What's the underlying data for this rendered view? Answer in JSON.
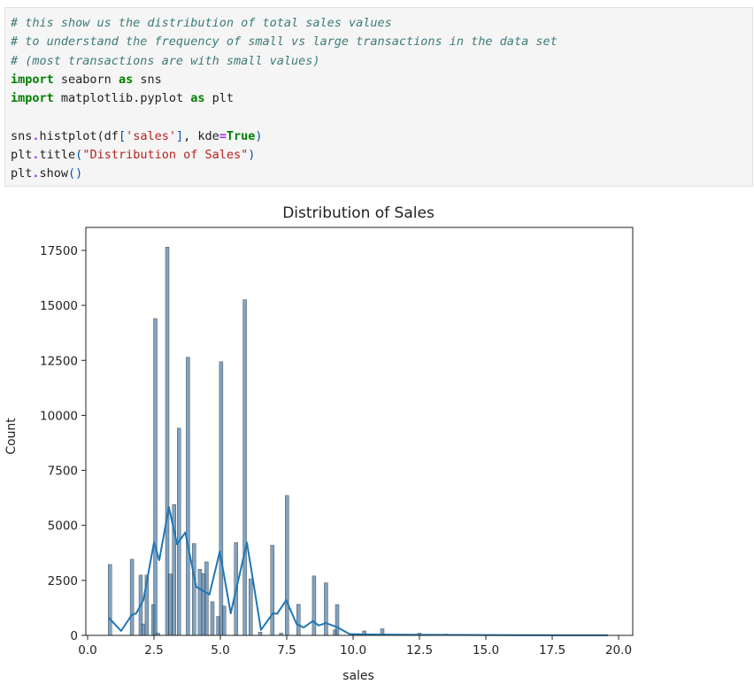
{
  "code_cell": {
    "comment1": "# this show us the distribution of total sales values",
    "comment2": "# to understand the frequency of small vs large transactions in the data set",
    "comment3": "# (most transactions are with small values)",
    "kw_import": "import",
    "kw_as": "as",
    "mod1": " seaborn ",
    "alias1": " sns",
    "mod2": " matplotlib.pyplot ",
    "alias2": " plt",
    "l6a": "sns",
    "dot": ".",
    "l6b": "histplot(df",
    "lb": "[",
    "l6str": "'sales'",
    "rb": "]",
    "l6c": ", kde",
    "eq": "=",
    "l6true": "True",
    "lp": "(",
    "rp": ")",
    "l7a": "plt",
    "l7b": "title",
    "l7str": "\"Distribution of Sales\"",
    "l8b": "show",
    "empty": "()"
  },
  "chart_data": {
    "type": "bar",
    "title": "Distribution of Sales",
    "xlabel": "sales",
    "ylabel": "Count",
    "xlim": [
      -0.1,
      20.5
    ],
    "ylim": [
      0,
      18500
    ],
    "xticks": [
      "0.0",
      "2.5",
      "5.0",
      "7.5",
      "10.0",
      "12.5",
      "15.0",
      "17.5",
      "20.0"
    ],
    "yticks": [
      "0",
      "2500",
      "5000",
      "7500",
      "10000",
      "12500",
      "15000",
      "17500"
    ],
    "bar_color": "#4a7ca8",
    "kde_color": "#1f77b4",
    "kde": true,
    "bars": [
      [
        0.84,
        3220
      ],
      [
        1.67,
        3460
      ],
      [
        2.0,
        2740
      ],
      [
        2.1,
        520
      ],
      [
        2.23,
        2740
      ],
      [
        2.48,
        1400
      ],
      [
        2.55,
        14400
      ],
      [
        2.65,
        100
      ],
      [
        3.0,
        17650
      ],
      [
        3.11,
        2790
      ],
      [
        3.26,
        5950
      ],
      [
        3.44,
        9420
      ],
      [
        3.78,
        12640
      ],
      [
        4.01,
        4180
      ],
      [
        4.23,
        3010
      ],
      [
        4.37,
        2810
      ],
      [
        4.48,
        3340
      ],
      [
        4.7,
        1530
      ],
      [
        4.92,
        860
      ],
      [
        5.03,
        12440
      ],
      [
        5.14,
        1330
      ],
      [
        5.59,
        4220
      ],
      [
        5.92,
        15260
      ],
      [
        6.14,
        2570
      ],
      [
        6.5,
        150
      ],
      [
        6.96,
        4100
      ],
      [
        7.29,
        100
      ],
      [
        7.51,
        6360
      ],
      [
        7.94,
        1410
      ],
      [
        8.53,
        2700
      ],
      [
        8.98,
        2390
      ],
      [
        9.32,
        250
      ],
      [
        9.4,
        1400
      ],
      [
        10.42,
        200
      ],
      [
        11.1,
        300
      ],
      [
        12.5,
        100
      ],
      [
        13.5,
        60
      ],
      [
        14.5,
        40
      ]
    ],
    "kde_points": [
      [
        0.8,
        800
      ],
      [
        1.26,
        200
      ],
      [
        1.66,
        920
      ],
      [
        1.83,
        1000
      ],
      [
        2.1,
        1600
      ],
      [
        2.5,
        4220
      ],
      [
        2.7,
        3420
      ],
      [
        3.06,
        5830
      ],
      [
        3.37,
        4140
      ],
      [
        3.68,
        4680
      ],
      [
        4.09,
        2210
      ],
      [
        4.59,
        1860
      ],
      [
        4.98,
        3820
      ],
      [
        5.39,
        1000
      ],
      [
        6.0,
        4220
      ],
      [
        6.53,
        250
      ],
      [
        6.98,
        1000
      ],
      [
        7.14,
        980
      ],
      [
        7.48,
        1600
      ],
      [
        7.87,
        520
      ],
      [
        8.14,
        360
      ],
      [
        8.48,
        650
      ],
      [
        8.7,
        450
      ],
      [
        8.98,
        560
      ],
      [
        9.42,
        360
      ],
      [
        9.87,
        60
      ],
      [
        10.5,
        40
      ],
      [
        12,
        30
      ],
      [
        14,
        20
      ],
      [
        16,
        10
      ],
      [
        19.6,
        5
      ]
    ]
  }
}
